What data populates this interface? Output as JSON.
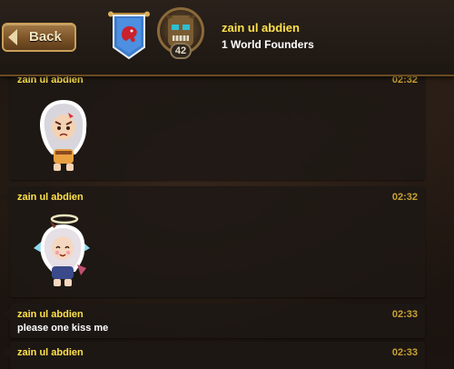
{
  "header": {
    "back_label": "Back",
    "player_name": "zain ul abdien",
    "guild_name": "1 World Founders",
    "level": "42",
    "back_icon": "chevron-left-icon",
    "banner_icon": "guild-banner-icon"
  },
  "messages": [
    {
      "name": "zain ul abdien",
      "time": "02:32",
      "text": "",
      "sticker": "sticker-angry-white-haired-hero"
    },
    {
      "name": "zain ul abdien",
      "time": "02:32",
      "text": "",
      "sticker": "sticker-happy-angel-hero"
    },
    {
      "name": "zain ul abdien",
      "time": "02:33",
      "text": "please one kiss me",
      "sticker": ""
    },
    {
      "name": "zain ul abdien",
      "time": "02:33",
      "text": "",
      "sticker": ""
    }
  ],
  "colors": {
    "name": "#ffe14a",
    "time": "#c9a233",
    "header_border": "#6a4a22",
    "bubble": "#1e1814"
  }
}
